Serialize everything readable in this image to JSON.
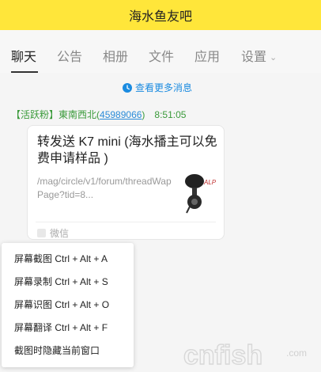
{
  "window": {
    "title": "海水鱼友吧"
  },
  "tabs": [
    {
      "label": "聊天"
    },
    {
      "label": "公告"
    },
    {
      "label": "相册"
    },
    {
      "label": "文件"
    },
    {
      "label": "应用"
    },
    {
      "label": "设置"
    }
  ],
  "chat": {
    "more_link": "查看更多消息",
    "message": {
      "badge": "【活跃粉】",
      "sender_name": "東南西北",
      "sender_id_open": "(",
      "sender_id": "45989066",
      "sender_id_close": ")",
      "time": "8:51:05",
      "card": {
        "title": "转发送 K7 mini (海水播主可以免费申请样品 )",
        "url": "/mag/circle/v1/forum/threadWapPage?tid=8...",
        "thumb_text": "ALP",
        "source": "微信"
      }
    }
  },
  "context_menu": {
    "items": [
      {
        "label": "屏幕截图 Ctrl + Alt + A"
      },
      {
        "label": "屏幕录制 Ctrl + Alt + S"
      },
      {
        "label": "屏幕识图 Ctrl + Alt + O"
      },
      {
        "label": "屏幕翻译 Ctrl + Alt + F"
      },
      {
        "label": "截图时隐藏当前窗口"
      }
    ]
  },
  "watermark": {
    "text": "cnfish",
    "suffix": ".com"
  },
  "colors": {
    "titlebar": "#ffe63a",
    "link": "#1a8be0",
    "sender": "#3a9a3a",
    "phone": "#f0a000"
  }
}
